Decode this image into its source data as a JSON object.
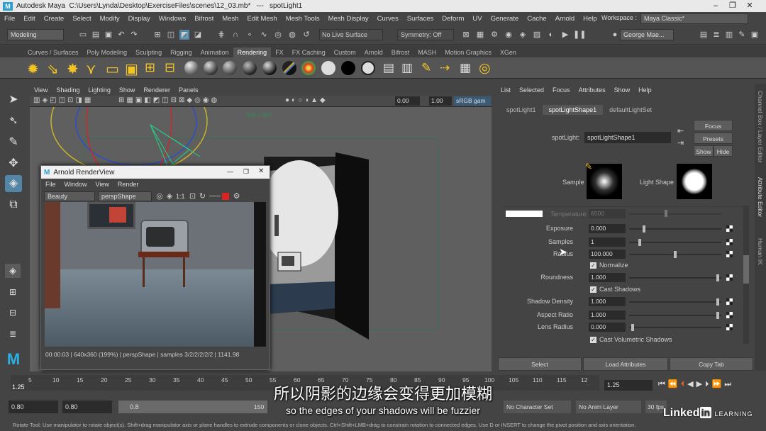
{
  "window": {
    "app": "Autodesk Maya",
    "file": "C:\\Users\\Lynda\\Desktop\\ExerciseFiles\\scenes\\12_03.mb*",
    "sep": "---",
    "object": "spotLight1"
  },
  "menubar": [
    "File",
    "Edit",
    "Create",
    "Select",
    "Modify",
    "Display",
    "Windows",
    "Bifrost",
    "Mesh",
    "Edit Mesh",
    "Mesh Tools",
    "Mesh Display",
    "Curves",
    "Surfaces",
    "Deform",
    "UV",
    "Generate",
    "Cache",
    "Arnold",
    "Help"
  ],
  "workspace": {
    "label": "Workspace :",
    "value": "Maya Classic*"
  },
  "status": {
    "mode": "Modeling",
    "live_surface": "No Live Surface",
    "symmetry": "Symmetry: Off",
    "user": "George Mae..."
  },
  "shelf_tabs": [
    "Curves / Surfaces",
    "Poly Modeling",
    "Sculpting",
    "Rigging",
    "Animation",
    "Rendering",
    "FX",
    "FX Caching",
    "Custom",
    "Arnold",
    "Bifrost",
    "MASH",
    "Motion Graphics",
    "XGen"
  ],
  "shelf_active": "Rendering",
  "viewport": {
    "menu": [
      "View",
      "Shading",
      "Lighting",
      "Show",
      "Renderer",
      "Panels"
    ],
    "value1": "0.00",
    "value2": "1.00",
    "colorspace": "sRGB gam",
    "resolution": "640 x 360"
  },
  "renderview": {
    "title": "Arnold RenderView",
    "menu": [
      "File",
      "Window",
      "View",
      "Render"
    ],
    "mode": "Beauty",
    "camera": "perspShape",
    "ratio": "1:1",
    "status": "00:00:03 | 640x360 (199%) | perspShape | samples 3/2/2/2/2/2 | 1141.98"
  },
  "attribute_editor": {
    "menu": [
      "List",
      "Selected",
      "Focus",
      "Attributes",
      "Show",
      "Help"
    ],
    "tabs": [
      "spotLight1",
      "spotLightShape1",
      "defaultLightSet"
    ],
    "node_label": "spotLight:",
    "node_value": "spotLightShape1",
    "focus": "Focus",
    "presets": "Presets",
    "show": "Show",
    "hide": "Hide",
    "sample_label": "Sample",
    "light_shape_label": "Light Shape",
    "temperature_label": "Temperature",
    "temperature_value": "6500",
    "attrs": [
      {
        "label": "Exposure",
        "value": "0.000",
        "level": 0.15
      },
      {
        "label": "Samples",
        "value": "1",
        "level": 0.1
      },
      {
        "label": "Radius",
        "value": "100.000",
        "level": 0.5
      }
    ],
    "normalize": "Normalize",
    "roundness_label": "Roundness",
    "roundness_value": "1.000",
    "roundness_level": 0.98,
    "cast_shadows": "Cast Shadows",
    "shadow_attrs": [
      {
        "label": "Shadow Density",
        "value": "1.000",
        "level": 0.98
      },
      {
        "label": "Aspect Ratio",
        "value": "1.000",
        "level": 0.98
      },
      {
        "label": "Lens Radius",
        "value": "0.000",
        "level": 0.02
      }
    ],
    "cast_volumetric": "Cast Volumetric Shadows",
    "buttons": [
      "Select",
      "Load Attributes",
      "Copy Tab"
    ]
  },
  "side_tabs": [
    "Channel Box / Layer Editor",
    "Attribute Editor",
    "Human IK"
  ],
  "timeline": {
    "ticks": [
      "5",
      "10",
      "15",
      "20",
      "25",
      "30",
      "35",
      "40",
      "45",
      "50",
      "55",
      "60",
      "65",
      "70",
      "75",
      "80",
      "85",
      "90",
      "95",
      "100",
      "105",
      "110",
      "115",
      "12"
    ],
    "current": "1.25",
    "frame_field": "1.25"
  },
  "range": {
    "start": "0.80",
    "start2": "0.80",
    "slider": "0.8",
    "end_marker": "150",
    "char_set": "No Character Set",
    "anim_layer": "No Anim Layer",
    "fps": "30 fps"
  },
  "subtitle": {
    "zh": "所以阴影的边缘会变得更加模糊",
    "en": "so the edges of your shadows will be fuzzier"
  },
  "watermark": {
    "brand": "Linked",
    "in": "in",
    "learning": "LEARNING"
  },
  "helpline": "Rotate Tool: Use manipulator to rotate object(s). Shift+drag manipulator axis or plane handles to extrude components or clone objects. Ctrl+Shift+LMB+drag to constrain rotation to connected edges. Use D or INSERT to change the pivot position and axis orientation."
}
